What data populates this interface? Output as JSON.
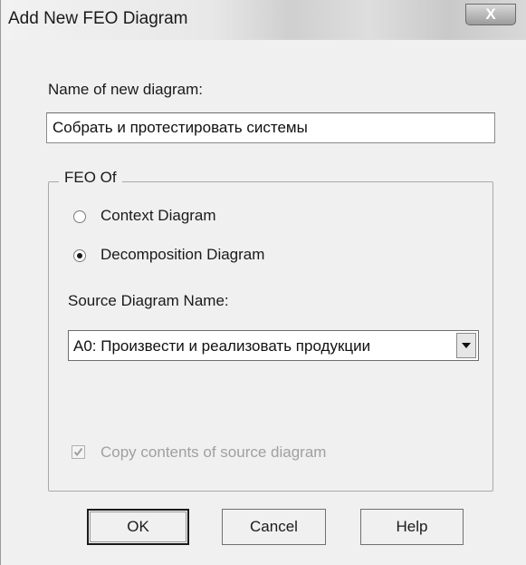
{
  "window": {
    "title": "Add New FEO Diagram",
    "close_glyph": "X"
  },
  "name_field": {
    "label": "Name of new diagram:",
    "value": "Собрать и протестировать системы"
  },
  "feo_group": {
    "legend": "FEO Of",
    "options": [
      {
        "label": "Context Diagram",
        "selected": false
      },
      {
        "label": "Decomposition Diagram",
        "selected": true
      }
    ],
    "source_label": "Source Diagram Name:",
    "source_value": "A0:  Произвести и  реализовать продукции",
    "copy_label": "Copy contents of source diagram",
    "copy_checked": true,
    "copy_enabled": false
  },
  "buttons": {
    "ok": "OK",
    "cancel": "Cancel",
    "help": "Help"
  }
}
